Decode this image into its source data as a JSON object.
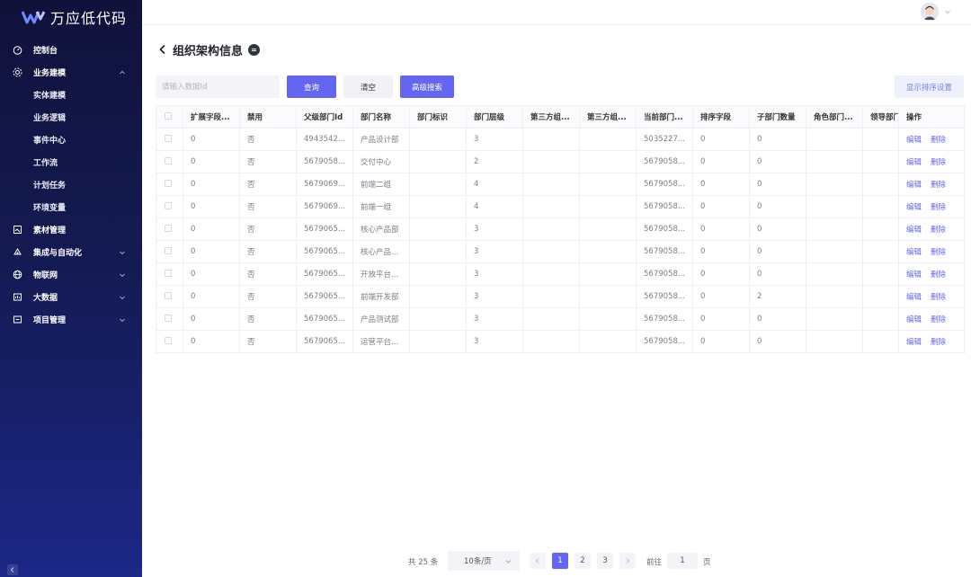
{
  "app": {
    "logo_text": "万应低代码"
  },
  "sidebar": {
    "items": [
      {
        "label": "控制台",
        "icon": "dashboard-icon"
      },
      {
        "label": "业务建模",
        "icon": "cube-icon",
        "expanded": true,
        "children": [
          "实体建模",
          "业务逻辑",
          "事件中心",
          "工作流",
          "计划任务",
          "环境变量"
        ]
      },
      {
        "label": "素材管理",
        "icon": "material-icon"
      },
      {
        "label": "集成与自动化",
        "icon": "integration-icon",
        "expandable": true
      },
      {
        "label": "物联网",
        "icon": "globe-icon",
        "expandable": true
      },
      {
        "label": "大数据",
        "icon": "bigdata-icon",
        "expandable": true
      },
      {
        "label": "项目管理",
        "icon": "project-icon",
        "expandable": true
      }
    ]
  },
  "page": {
    "title": "组织架构信息"
  },
  "toolbar": {
    "search_placeholder": "请输入数据Id",
    "query_label": "查询",
    "clear_label": "清空",
    "advanced_label": "高级搜索",
    "sort_label": "显示排序设置"
  },
  "table": {
    "columns": [
      "扩展字段...",
      "禁用",
      "父级部门Id",
      "部门名称",
      "部门标识",
      "部门层级",
      "第三方组...",
      "第三方组...",
      "当前部门...",
      "排序字段",
      "子部门数量",
      "角色部门...",
      "领导部门",
      "操作"
    ],
    "edit_label": "编辑",
    "delete_label": "删除",
    "rows": [
      [
        "0",
        "否",
        "4943542...",
        "产品设计部",
        "",
        "3",
        "",
        "",
        "5035227...",
        "0",
        "0",
        "",
        ""
      ],
      [
        "0",
        "否",
        "5679058...",
        "交付中心",
        "",
        "2",
        "",
        "",
        "5679058...",
        "0",
        "0",
        "",
        ""
      ],
      [
        "0",
        "否",
        "5679069...",
        "前端二组",
        "",
        "4",
        "",
        "",
        "5679058...",
        "0",
        "0",
        "",
        ""
      ],
      [
        "0",
        "否",
        "5679069...",
        "前端一组",
        "",
        "4",
        "",
        "",
        "5679058...",
        "0",
        "0",
        "",
        ""
      ],
      [
        "0",
        "否",
        "5679065...",
        "核心产品部",
        "",
        "3",
        "",
        "",
        "5679058...",
        "0",
        "0",
        "",
        ""
      ],
      [
        "0",
        "否",
        "5679065...",
        "核心产品...",
        "",
        "3",
        "",
        "",
        "5679058...",
        "0",
        "0",
        "",
        ""
      ],
      [
        "0",
        "否",
        "5679065...",
        "开放平台...",
        "",
        "3",
        "",
        "",
        "5679058...",
        "0",
        "0",
        "",
        ""
      ],
      [
        "0",
        "否",
        "5679065...",
        "前端开发部",
        "",
        "3",
        "",
        "",
        "5679058...",
        "0",
        "2",
        "",
        ""
      ],
      [
        "0",
        "否",
        "5679065...",
        "产品测试部",
        "",
        "3",
        "",
        "",
        "5679058...",
        "0",
        "0",
        "",
        ""
      ],
      [
        "0",
        "否",
        "5679065...",
        "运营平台...",
        "",
        "3",
        "",
        "",
        "5679058...",
        "0",
        "0",
        "",
        ""
      ]
    ]
  },
  "pagination": {
    "total_text": "共 25 条",
    "page_size": "10条/页",
    "pages": [
      "1",
      "2",
      "3"
    ],
    "current_page": "1",
    "goto_label": "前往",
    "goto_value": "1",
    "page_suffix": "页"
  },
  "colors": {
    "accent": "#6366f1",
    "sidebar_top": "#10123a",
    "sidebar_bottom": "#1c2787"
  }
}
